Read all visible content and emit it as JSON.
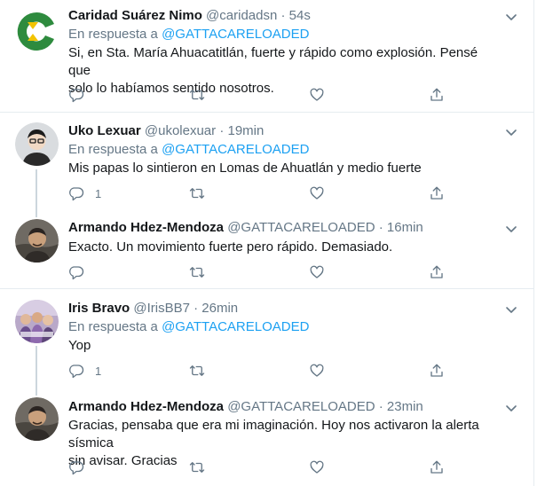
{
  "tweets": [
    {
      "name": "Caridad Suárez Nimo",
      "handle": "@caridadsn",
      "dot": "·",
      "time": "54s",
      "reply_prefix": "En respuesta a ",
      "reply_mention": "@GATTACARELOADED",
      "text_lines": [
        "Si, en Sta. María Ahuacatitlán, fuerte y rápido como explosión. Pensé que",
        "solo lo habíamos sentido nosotros."
      ],
      "reply_count": ""
    },
    {
      "name": "Uko Lexuar",
      "handle": "@ukolexuar",
      "dot": "·",
      "time": "19min",
      "reply_prefix": "En respuesta a ",
      "reply_mention": "@GATTACARELOADED",
      "text_lines": [
        "Mis papas lo sintieron en Lomas de Ahuatlán y medio fuerte"
      ],
      "reply_count": "1"
    },
    {
      "name": "Armando Hdez-Mendoza",
      "handle": "@GATTACARELOADED",
      "dot": "·",
      "time": "16min",
      "text_lines": [
        "Exacto. Un movimiento fuerte pero rápido. Demasiado."
      ],
      "reply_count": ""
    },
    {
      "name": "Iris Bravo",
      "handle": "@IrisBB7",
      "dot": "·",
      "time": "26min",
      "reply_prefix": "En respuesta a ",
      "reply_mention": "@GATTACARELOADED",
      "text_lines": [
        "Yop"
      ],
      "reply_count": "1"
    },
    {
      "name": "Armando Hdez-Mendoza",
      "handle": "@GATTACARELOADED",
      "dot": "·",
      "time": "23min",
      "text_lines": [
        "Gracias, pensaba que era mi imaginación. Hoy nos activaron la alerta sísmica",
        "sin avisar. Gracias"
      ],
      "reply_count": ""
    }
  ],
  "icons": {
    "reply": "reply-icon",
    "retweet": "retweet-icon",
    "like": "heart-icon",
    "share": "share-icon",
    "more": "chevron-down-icon"
  },
  "colors": {
    "accent": "#1da1f2",
    "secondary_text": "#657786",
    "divider": "#e6ecf0",
    "thread_line": "#ccd6dd"
  }
}
